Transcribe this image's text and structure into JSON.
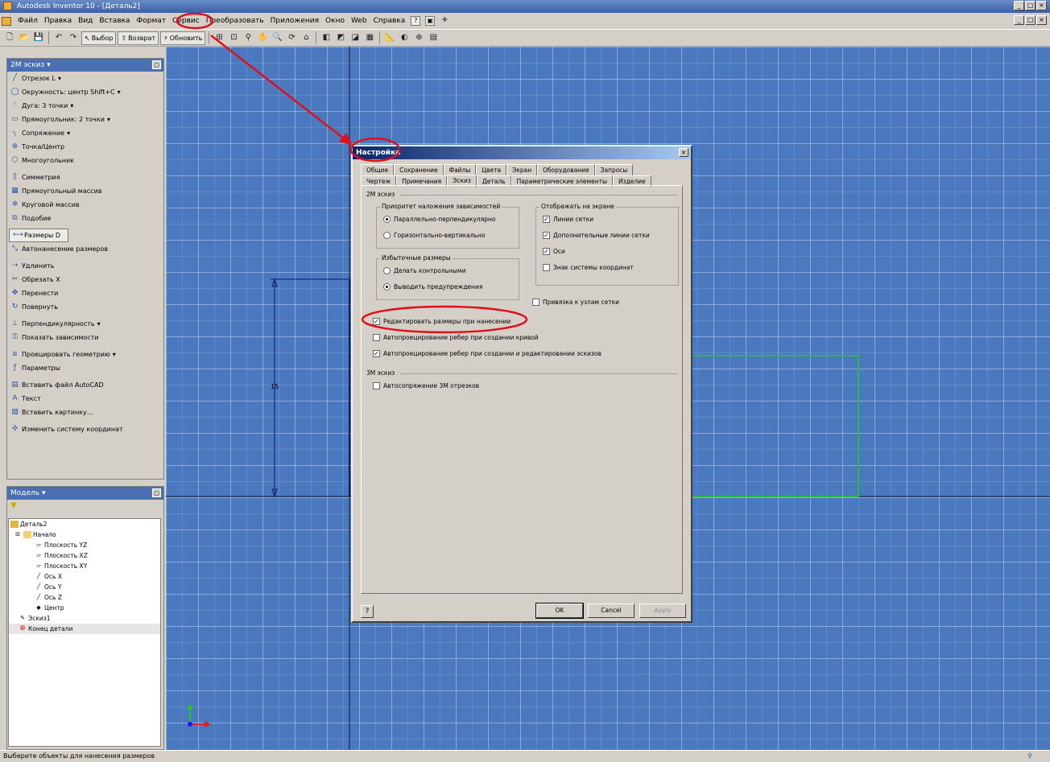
{
  "window": {
    "title": "Autodesk Inventor 10 - [Деталь2]"
  },
  "menu": {
    "items": [
      "Файл",
      "Правка",
      "Вид",
      "Вставка",
      "Формат",
      "Сервис",
      "Преобразовать",
      "Приложения",
      "Окно",
      "Web",
      "Справка"
    ]
  },
  "toolbar": {
    "select_label": "Выбор",
    "return_label": "Возврат",
    "update_label": "Обновить"
  },
  "sketch_panel": {
    "title": "2М эскиз",
    "items": [
      "Отрезок  L",
      "Окружность: центр  Shift+C",
      "Дуга: 3 точки",
      "Прямоугольник: 2 точки",
      "Сопряжение",
      "Точка/Центр",
      "Многоугольник",
      "Симметрия",
      "Прямоугольный массив",
      "Круговой массив",
      "Подобие",
      "Размеры  D",
      "Автонанесение размеров",
      "Удлинить",
      "Обрезать  X",
      "Перенести",
      "Повернуть",
      "Перпендикулярность",
      "Показать зависимости",
      "Проецировать геометрию",
      "Параметры",
      "Вставить файл AutoCAD",
      "Текст",
      "Вставить картинку...",
      "Изменить систему координат"
    ]
  },
  "model_panel": {
    "title": "Модель",
    "tree": [
      "Деталь2",
      "Начало",
      "Плоскость YZ",
      "Плоскость XZ",
      "Плоскость XY",
      "Ось X",
      "Ось Y",
      "Ось Z",
      "Центр",
      "Эскиз1",
      "Конец детали"
    ]
  },
  "canvas": {
    "dimension_value": "15"
  },
  "dialog": {
    "title": "Настройка",
    "tabs_row1": [
      "Общие",
      "Сохранение",
      "Файлы",
      "Цвета",
      "Экран",
      "Оборудование",
      "Запросы"
    ],
    "tabs_row2": [
      "Чертеж",
      "Примечания",
      "Эскиз",
      "Деталь",
      "Параметрические элементы",
      "Изделие"
    ],
    "section_2d": "2М эскиз",
    "constraint_group": {
      "title": "Приоритет наложения зависимостей",
      "options": [
        "Параллельно-перпендикулярно",
        "Горизонтально-вертикально"
      ],
      "selected": 0
    },
    "display_group": {
      "title": "Отображать на экране",
      "options": [
        "Линии сетки",
        "Дополнительные линии сетки",
        "Оси",
        "Знак системы координат"
      ],
      "checked": [
        true,
        true,
        true,
        false
      ]
    },
    "overdim_group": {
      "title": "Избыточные размеры",
      "options": [
        "Делать контрольными",
        "Выводить предупреждения"
      ],
      "selected": 1
    },
    "snap_grid": {
      "label": "Привязка к узлам сетки",
      "checked": false
    },
    "edit_dims": {
      "label": "Редактировать размеры при нанесении",
      "checked": true
    },
    "autoproject_curve": {
      "label": "Автопроецирование ребер при создании кривой",
      "checked": false
    },
    "autoproject_sketch": {
      "label": "Автопроецирование ребер при создании и редактировании эскизов",
      "checked": true
    },
    "section_3d": "3М эскиз",
    "autofillet_3d": {
      "label": "Автосопряжение 3М отрезков",
      "checked": false
    },
    "ok_label": "OK",
    "cancel_label": "Cancel",
    "apply_label": "Apply"
  },
  "status": {
    "text": "Выберите объекты для нанесения размеров"
  },
  "colors": {
    "canvas": "#4a79bf",
    "annotation": "#e0101a",
    "sketch_green": "#2fb84a"
  }
}
